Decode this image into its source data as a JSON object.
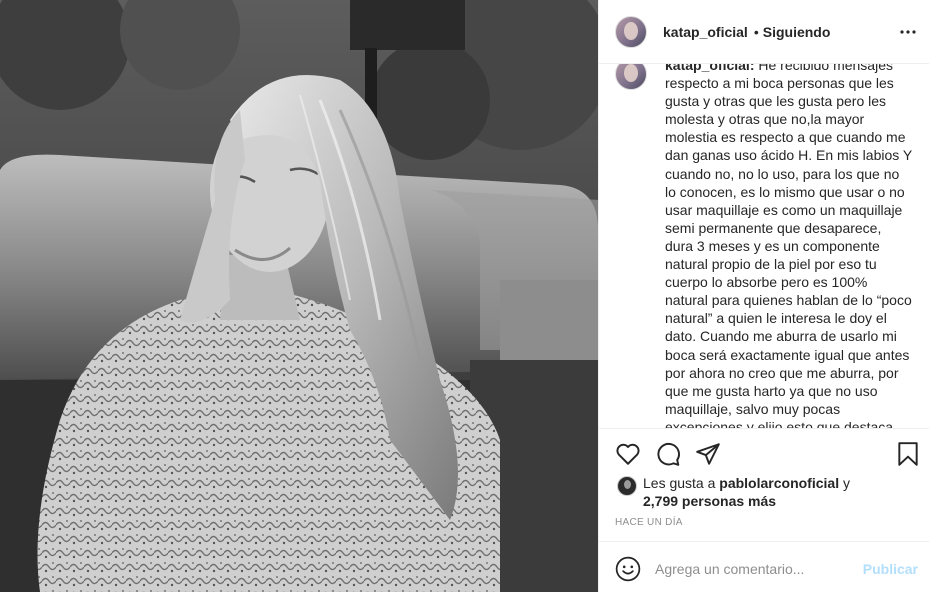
{
  "post": {
    "username": "katap_oficial",
    "separator": "•",
    "follow_state": "Siguiendo"
  },
  "caption": {
    "username": "katap_oficial:",
    "text": " He recibido mensajes respecto a mi boca personas que les gusta y otras que les gusta pero les molesta y otras que no,la mayor molestia es respecto a que cuando me dan ganas uso ácido H. En mis labios Y cuando no, no lo uso, para los que no lo conocen, es lo mismo que usar o no usar maquillaje es como un maquillaje semi permanente que desaparece, dura 3 meses y es un componente natural propio de la piel por eso tu cuerpo lo absorbe pero es 100% natural para quienes hablan de lo “poco natural” a quien le interesa le doy el dato. Cuando me aburra de usarlo mi boca será exactamente igual que antes por ahora no creo que me aburra, por que me gusta harto ya que no uso maquillaje, salvo muy pocas excepciones y elijo esto que destaca"
  },
  "likes": {
    "prefix": "Les gusta a ",
    "liker": "pablolarconoficial",
    "joiner": " y",
    "count_text": "2,799 personas más"
  },
  "timestamp": "HACE UN DÍA",
  "add_comment": {
    "placeholder": "Agrega un comentario...",
    "publish_label": "Publicar"
  },
  "icons": {
    "more": "more-options-icon",
    "like": "heart-icon",
    "comment": "comment-icon",
    "share": "share-icon",
    "save": "bookmark-icon",
    "emoji": "emoji-icon"
  },
  "colors": {
    "text": "#262626",
    "secondary": "#8e8e8e",
    "border": "#efefef",
    "publish_disabled": "#b2dffc"
  }
}
